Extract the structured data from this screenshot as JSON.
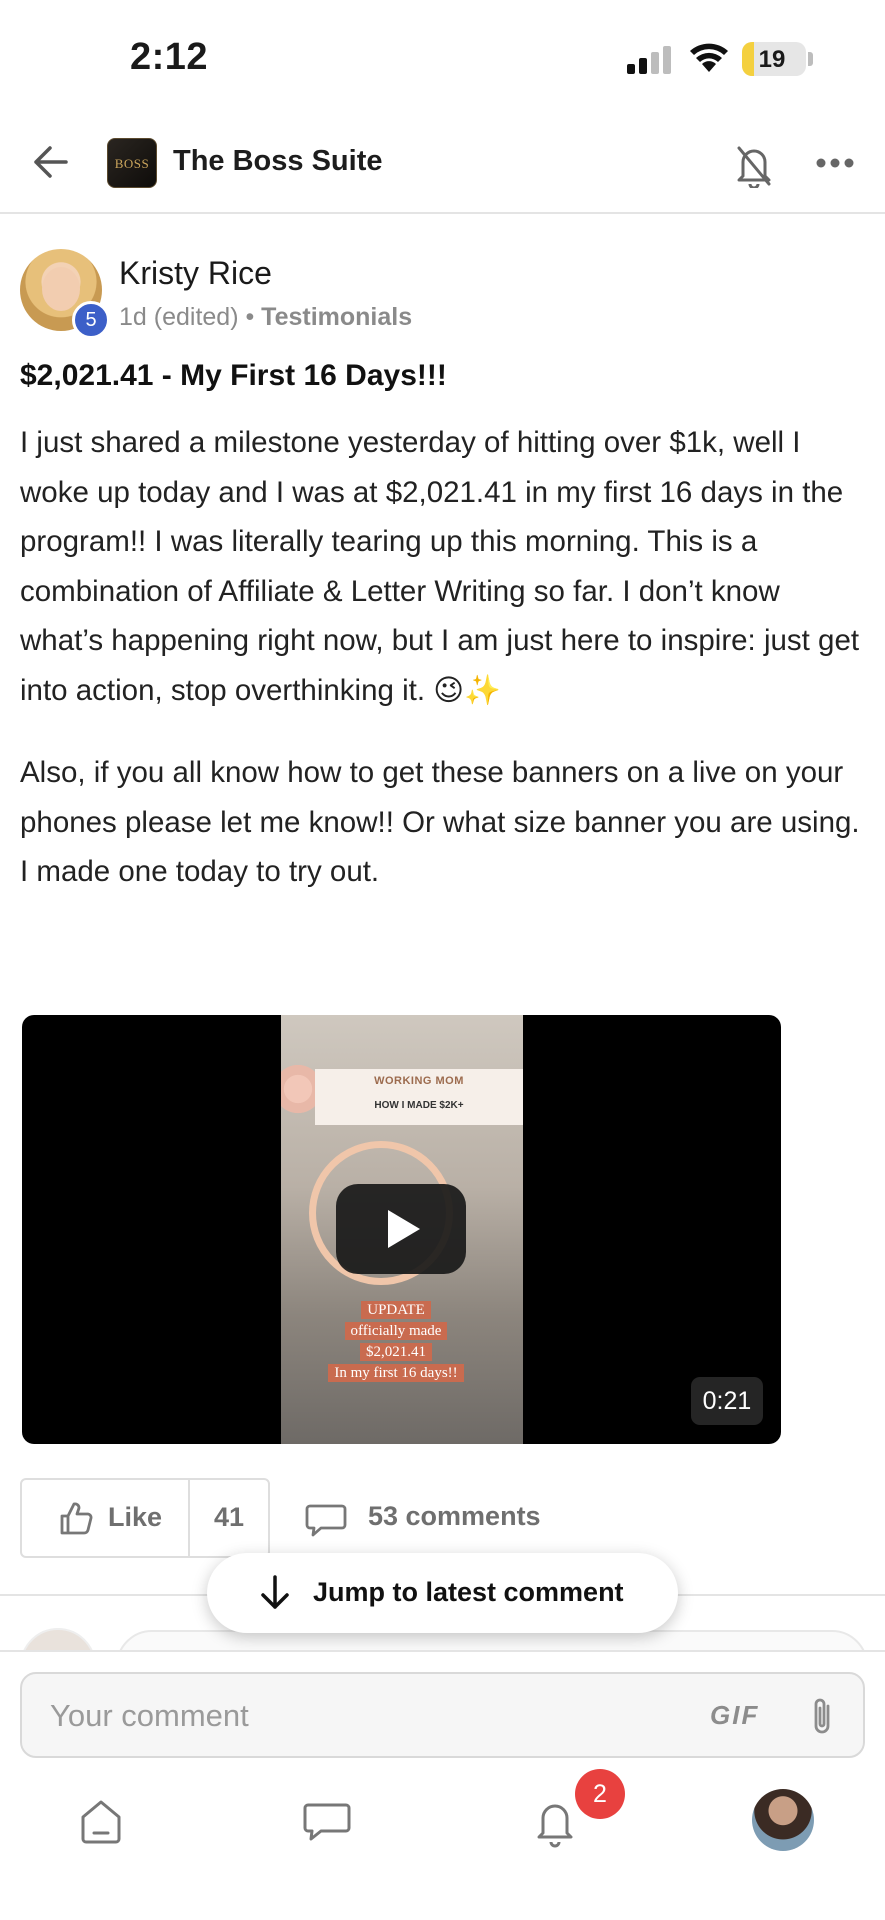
{
  "status_bar": {
    "time": "2:12",
    "battery": "19",
    "battery_level": 0.19
  },
  "header": {
    "group_name": "The Boss Suite",
    "logo_text": "BOSS",
    "icons": [
      "back-arrow-icon",
      "bell-off-icon",
      "more-icon"
    ]
  },
  "post": {
    "author": "Kristy Rice",
    "level": "5",
    "meta_time": "1d (edited) • ",
    "category": "Testimonials",
    "title": "$2,021.41 - My First 16 Days!!!",
    "paragraph1": "I just shared a milestone yesterday of hitting over $1k, well I woke up today and I was at $2,021.41 in my first 16 days in the program!! I was literally tearing up this morning. This is a combination of Affiliate & Letter Writing so far. I don’t know what’s happening right now, but I am just here to inspire: just get into action, stop overthinking it. 😉✨",
    "paragraph2": "Also, if you all know how to get these banners on a live on your phones please let me know!! Or what size banner you are using. I made one today to try out."
  },
  "video": {
    "duration": "0:21",
    "banner_title": "WORKING MOM",
    "banner_sub": "HOW I MADE $2K+",
    "overlay_lines": [
      "UPDATE",
      "officially made",
      "$2,021.41",
      "In my first 16 days!!"
    ]
  },
  "actions": {
    "like_label": "Like",
    "like_count": "41",
    "comments_label": "53 comments",
    "jump_label": "Jump to latest comment"
  },
  "composer": {
    "placeholder": "Your comment",
    "gif_label": "GIF"
  },
  "tab_bar": {
    "notification_count": "2",
    "tabs": [
      "home-icon",
      "chat-icon",
      "bell-icon",
      "profile-avatar"
    ]
  },
  "colors": {
    "level_badge": "#3c5fc8",
    "notification_badge": "#e8413f",
    "battery_fill": "#f4d03f"
  }
}
